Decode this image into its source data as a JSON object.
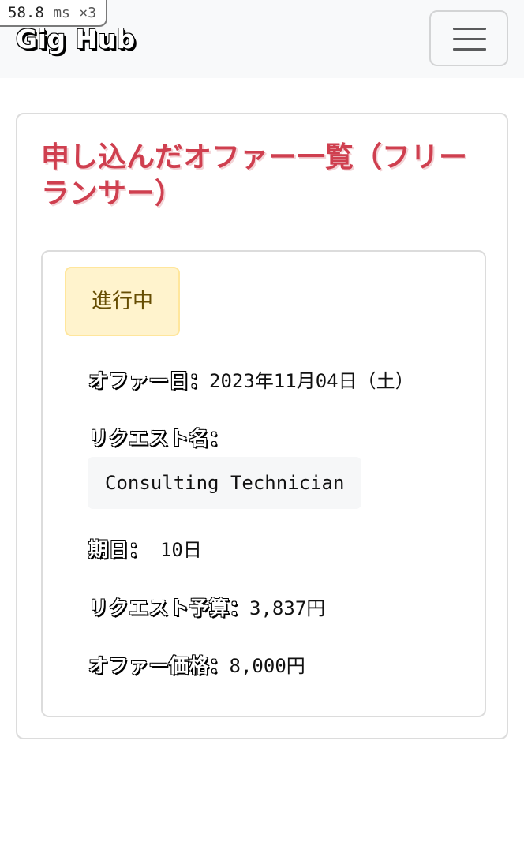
{
  "perf": {
    "value": "58.8",
    "unit": "ms",
    "multiplier": "×3"
  },
  "navbar": {
    "brand": "Gig Hub",
    "toggler_icon": "hamburger-icon"
  },
  "page": {
    "title": "申し込んだオファー一覧（フリーランサー）"
  },
  "offer": {
    "status": "進行中",
    "date_label": "オファー日：",
    "date_value": "2023年11月04日（土）",
    "request_name_label": "リクエスト名：",
    "request_name_value": "Consulting Technician",
    "deadline_label": "期日：",
    "deadline_value": " 10日",
    "budget_label": "リクエスト予算：",
    "budget_value": "3,837円",
    "price_label": "オファー価格：",
    "price_value": "8,000円"
  },
  "colors": {
    "title": "#cf3f4f",
    "status_bg": "#fff3cd",
    "status_text": "#664d03",
    "navbar_bg": "#f8f9fa"
  }
}
